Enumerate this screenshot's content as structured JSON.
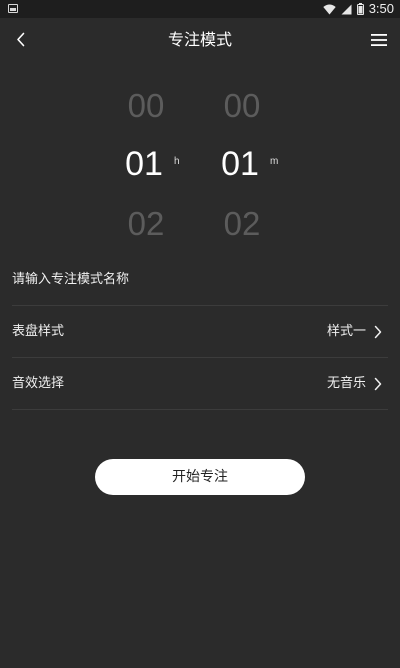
{
  "statusbar": {
    "time": "3:50"
  },
  "header": {
    "title": "专注模式"
  },
  "picker": {
    "hours": {
      "prev": "00",
      "selected": "01",
      "next": "02",
      "unit": "h"
    },
    "minutes": {
      "prev": "00",
      "selected": "01",
      "next": "02",
      "unit": "m"
    }
  },
  "form": {
    "name_placeholder": "请输入专注模式名称",
    "dial_style": {
      "label": "表盘样式",
      "value": "样式一"
    },
    "sound": {
      "label": "音效选择",
      "value": "无音乐"
    }
  },
  "actions": {
    "start_label": "开始专注"
  }
}
